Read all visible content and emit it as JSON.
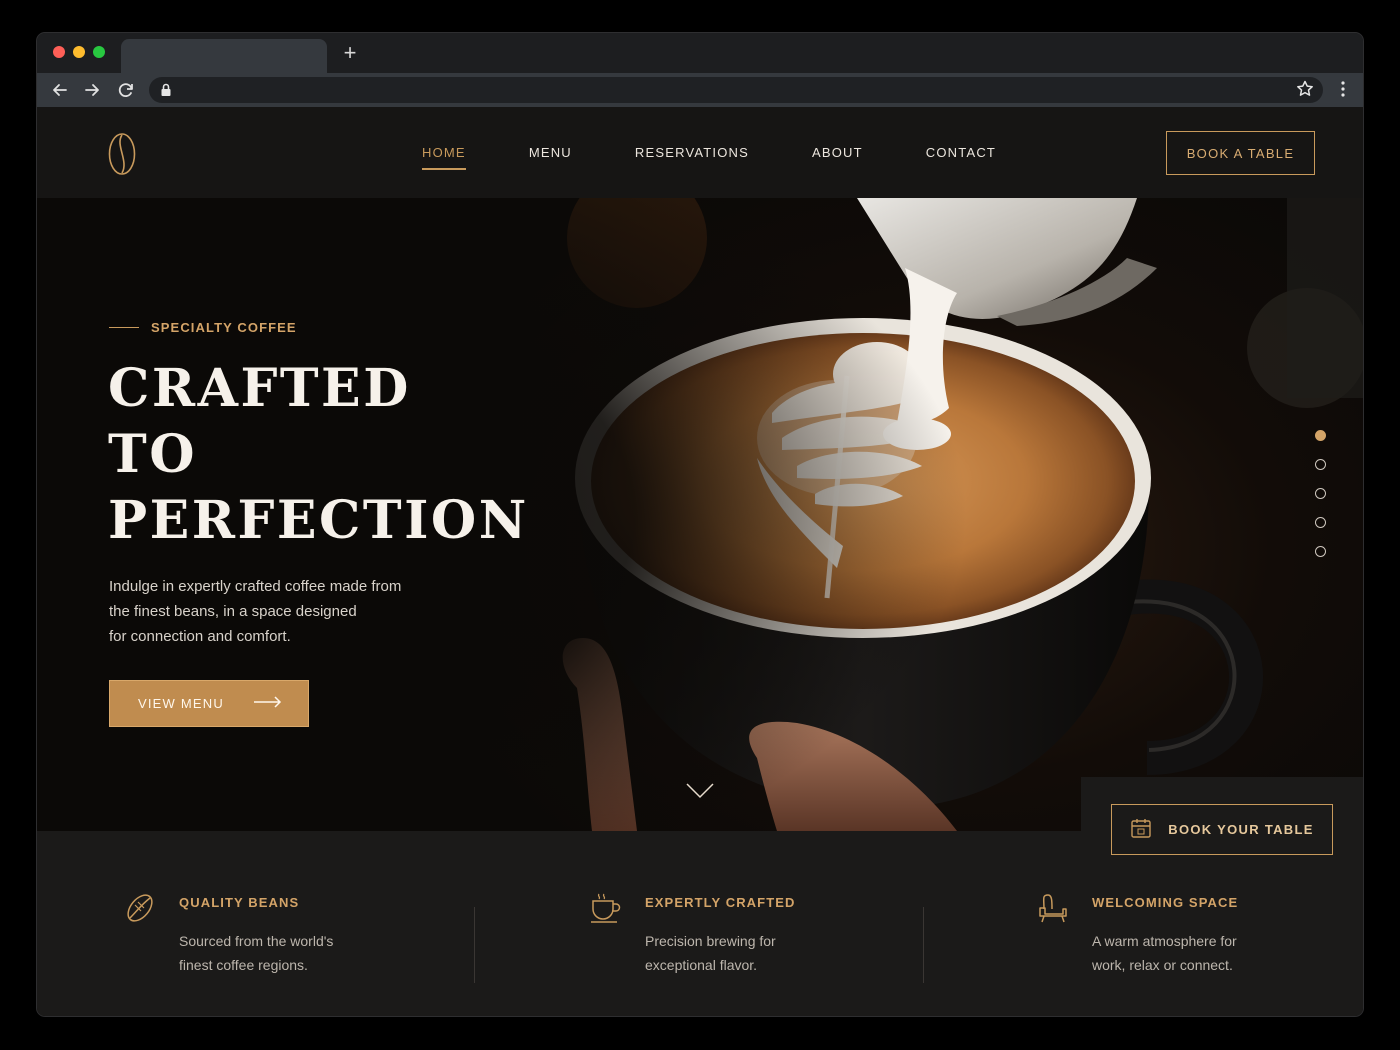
{
  "browser": {
    "new_tab_glyph": "+"
  },
  "nav": {
    "items": [
      {
        "label": "HOME",
        "active": true
      },
      {
        "label": "MENU",
        "active": false
      },
      {
        "label": "RESERVATIONS",
        "active": false
      },
      {
        "label": "ABOUT",
        "active": false
      },
      {
        "label": "CONTACT",
        "active": false
      }
    ],
    "cta": "BOOK A TABLE"
  },
  "hero": {
    "eyebrow": "SPECIALTY COFFEE",
    "headline": [
      "CRAFTED",
      "TO",
      "PERFECTION"
    ],
    "description": [
      "Indulge in expertly crafted coffee made from",
      "the finest beans, in a space designed",
      "for connection and comfort."
    ],
    "button": "VIEW MENU",
    "slides": 5,
    "active_slide": 1
  },
  "booking": {
    "button": "BOOK YOUR TABLE"
  },
  "features": [
    {
      "icon": "coffee-bean-icon",
      "title": "QUALITY BEANS",
      "description": [
        "Sourced from the world's",
        "finest coffee regions."
      ]
    },
    {
      "icon": "coffee-cup-icon",
      "title": "EXPERTLY CRAFTED",
      "description": [
        "Precision brewing for",
        "exceptional flavor."
      ]
    },
    {
      "icon": "armchair-icon",
      "title": "WELCOMING SPACE",
      "description": [
        "A warm atmosphere for",
        "work, relax or connect."
      ]
    }
  ],
  "colors": {
    "accent": "#c89a5c",
    "background": "#151413",
    "button_fill": "#c08c4f"
  }
}
